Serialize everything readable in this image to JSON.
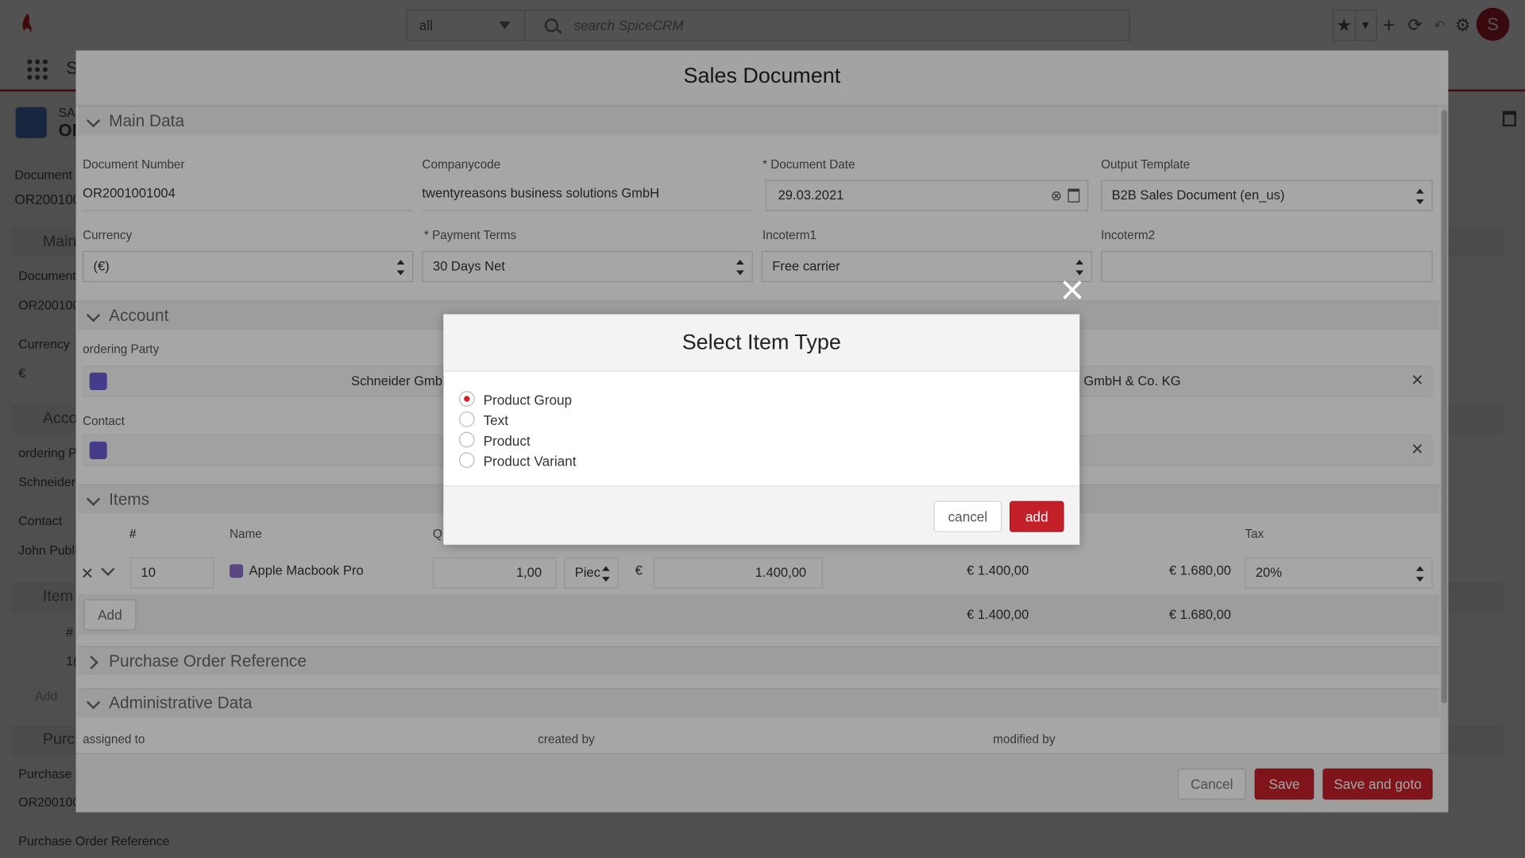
{
  "topbar": {
    "scope_value": "all",
    "search_placeholder": "search SpiceCRM"
  },
  "background": {
    "nav_initial": "S",
    "header_small": "SA",
    "header_big": "OI",
    "doc_number_label": "Document N",
    "doc_number_value": "OR200100",
    "main_section": "Main",
    "doc_label": "Document I",
    "doc_value": "OR200100",
    "currency_label": "Currency",
    "currency_value": "€",
    "account_section": "Acco",
    "ordering_label": "ordering Pa",
    "ordering_value": "Schneider",
    "contact_label": "Contact",
    "contact_value": "John Publi",
    "items_section": "Item",
    "items_hash": "#",
    "item_num": "1(",
    "add_label": "Add",
    "purch_section": "Purc",
    "purch_label": "Purchase O",
    "purch_value": "OR200100",
    "purch_ref_label": "Purchase Order Reference"
  },
  "modal": {
    "title": "Sales Document",
    "sections": {
      "main_data": "Main Data",
      "account": "Account",
      "items": "Items",
      "purchase_order_reference": "Purchase Order Reference",
      "administrative_data": "Administrative Data"
    },
    "fields": {
      "document_number_label": "Document Number",
      "document_number_value": "OR2001001004",
      "companycode_label": "Companycode",
      "companycode_value": "twentyreasons business solutions GmbH",
      "document_date_label": "* Document Date",
      "document_date_value": "29.03.2021",
      "output_template_label": "Output Template",
      "output_template_value": "B2B Sales Document (en_us)",
      "currency_label": "Currency",
      "currency_value": "(€)",
      "payment_terms_label": "* Payment Terms",
      "payment_terms_value": "30 Days Net",
      "incoterm1_label": "Incoterm1",
      "incoterm1_value": "Free carrier",
      "incoterm2_label": "Incoterm2",
      "incoterm2_value": "",
      "ordering_party_label": "ordering Party",
      "ordering_party_value": "Schneider GmbH",
      "ordering_party_right": "r GmbH & Co. KG",
      "contact_label": "Contact"
    },
    "items": {
      "col_hash": "#",
      "col_name": "Name",
      "col_qty": "Q",
      "col_tax": "Tax",
      "row": {
        "position": "10",
        "name": "Apple Macbook Pro",
        "quantity": "1,00",
        "unit": "Piec",
        "currency": "€",
        "price": "1.400,00",
        "net": "€ 1.400,00",
        "gross": "€ 1.680,00",
        "tax": "20%"
      },
      "add_label": "Add",
      "total_net": "€ 1.400,00",
      "total_gross": "€ 1.680,00"
    },
    "admin": {
      "assigned_to": "assigned to",
      "created_by": "created by",
      "modified_by": "modified by"
    },
    "footer": {
      "cancel": "Cancel",
      "save": "Save",
      "save_and_goto": "Save and goto"
    }
  },
  "dialog": {
    "title": "Select Item Type",
    "options": [
      {
        "label": "Product Group",
        "selected": true
      },
      {
        "label": "Text",
        "selected": false
      },
      {
        "label": "Product",
        "selected": false
      },
      {
        "label": "Product Variant",
        "selected": false
      }
    ],
    "cancel": "cancel",
    "add": "add"
  },
  "colors": {
    "accent": "#c4202a",
    "overlay": "rgba(0,0,0,0.5)",
    "icon_purple": "#6b5bd6"
  }
}
